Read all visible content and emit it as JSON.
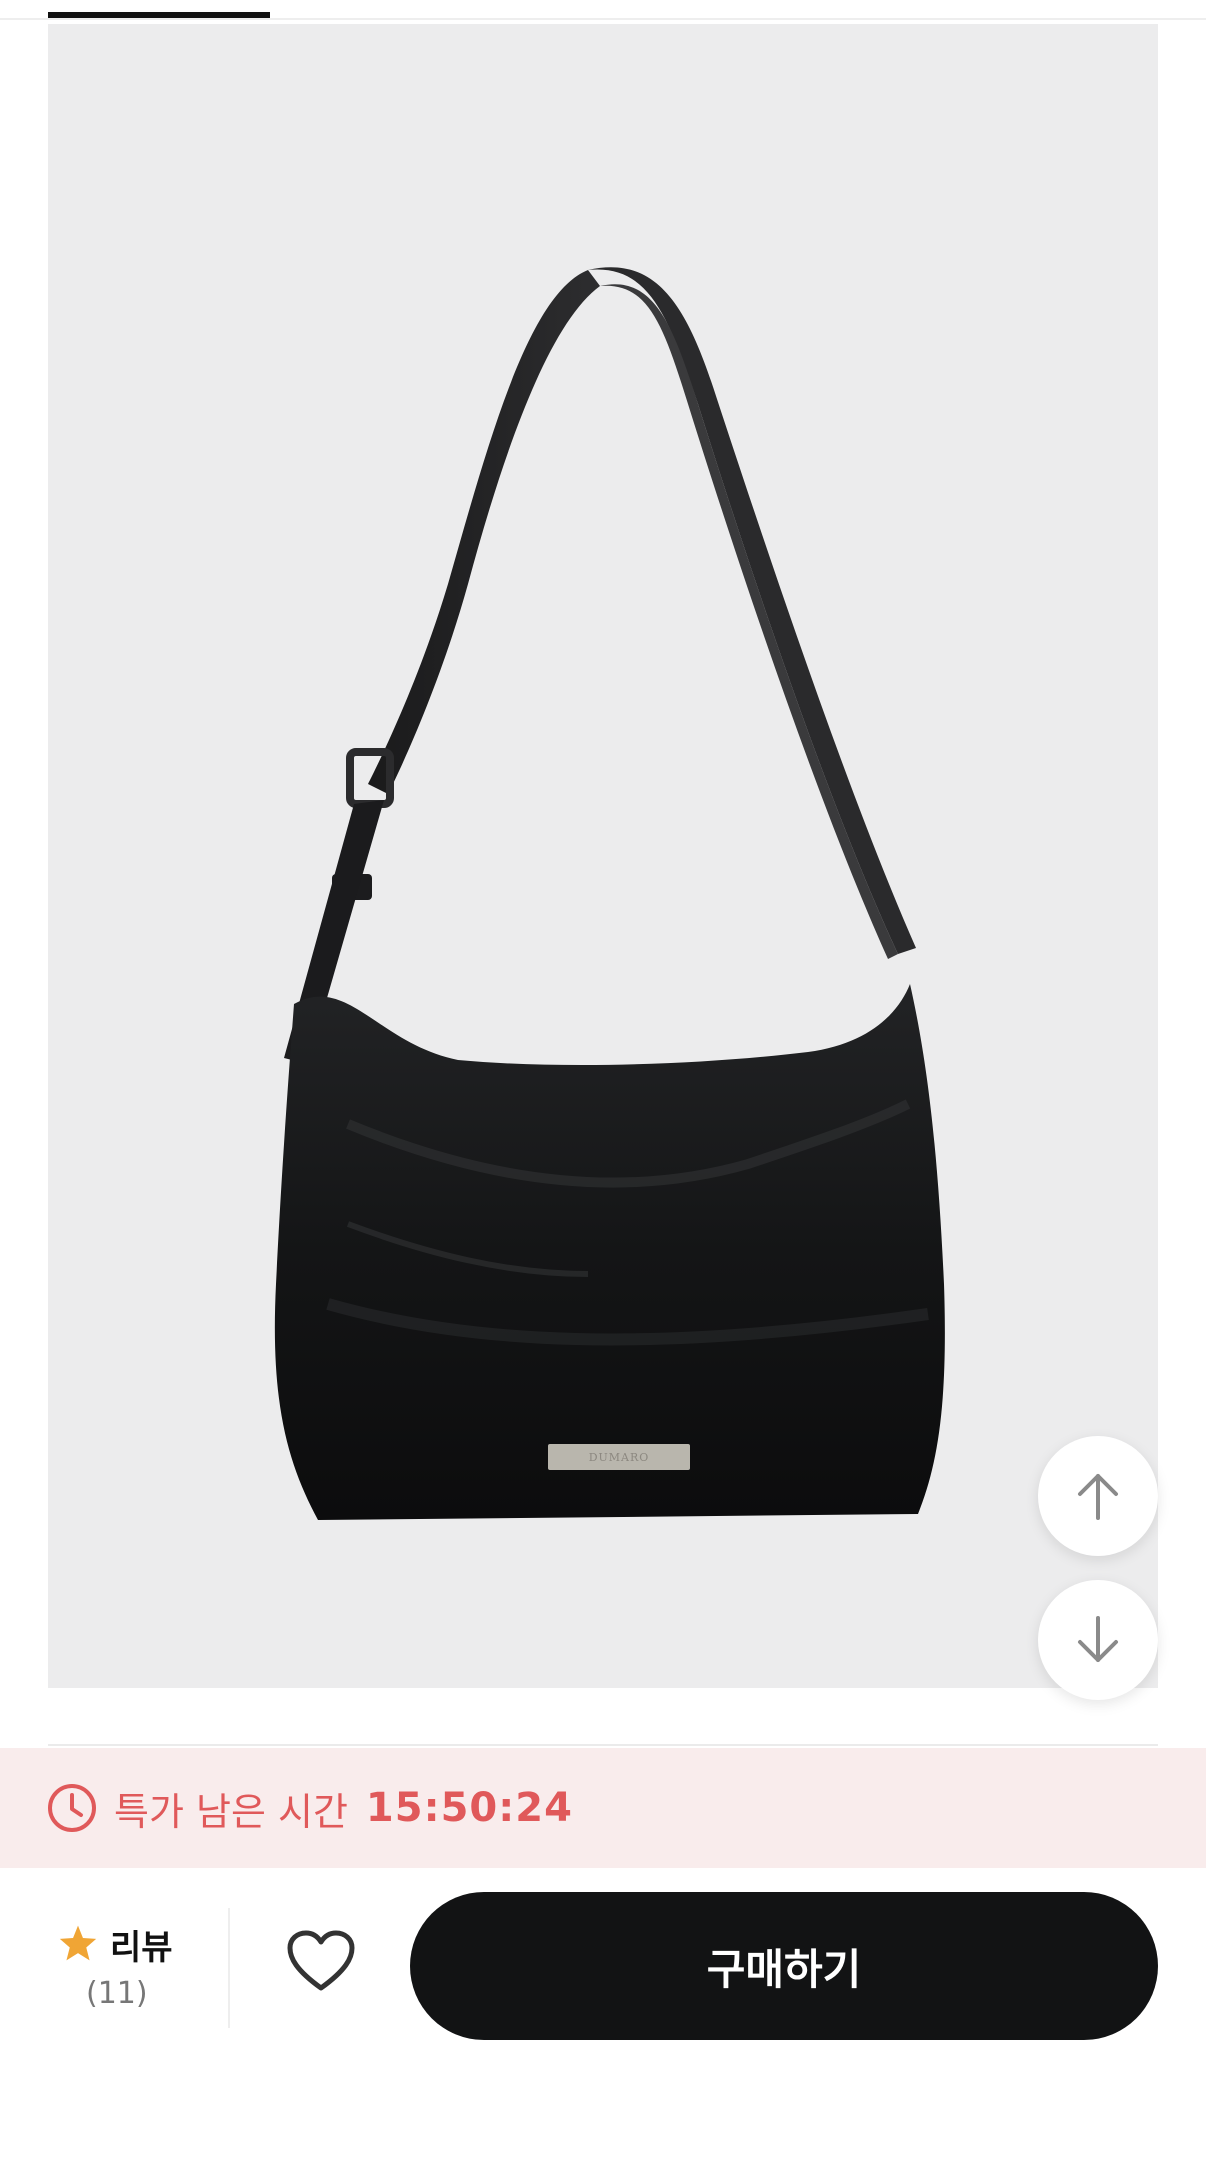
{
  "product": {
    "image_alt": "black nylon shoulder bag",
    "logo_text": "DUMARO"
  },
  "scroll": {
    "up_icon": "arrow-up-icon",
    "down_icon": "arrow-down-icon"
  },
  "sale": {
    "icon": "clock-icon",
    "label": "특가 남은 시간",
    "time": "15:50:24",
    "color": "#e0595a",
    "background": "#f9ecec"
  },
  "bottom_bar": {
    "review_icon": "star-icon",
    "review_label": "리뷰",
    "review_count": "(11)",
    "like_icon": "heart-icon",
    "buy_label": "구매하기",
    "buy_color": "#121314",
    "star_color": "#f0a535"
  }
}
